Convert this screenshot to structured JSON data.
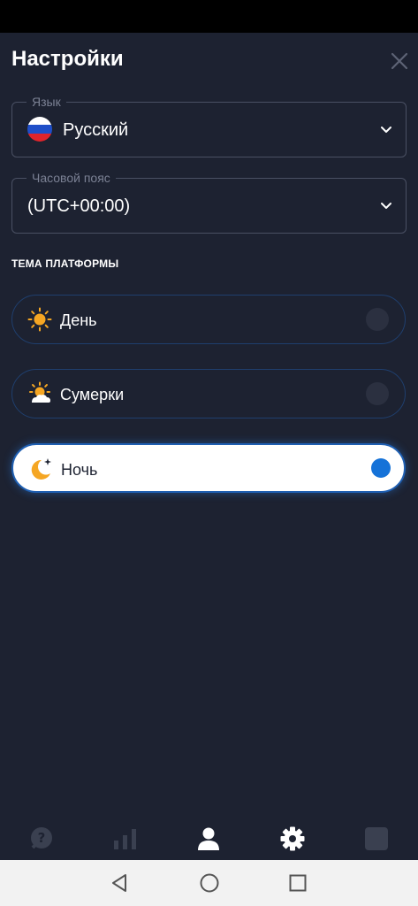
{
  "header": {
    "title": "Настройки"
  },
  "language": {
    "legend": "Язык",
    "value": "Русский",
    "flag": "russia-flag"
  },
  "timezone": {
    "legend": "Часовой пояс",
    "value": "(UTC+00:00)"
  },
  "theme": {
    "section_title": "ТЕМА ПЛАТФОРМЫ",
    "options": [
      {
        "label": "День",
        "icon": "sun-icon",
        "selected": false
      },
      {
        "label": "Сумерки",
        "icon": "sun-cloud-icon",
        "selected": false
      },
      {
        "label": "Ночь",
        "icon": "moon-icon",
        "selected": true
      }
    ]
  },
  "bottom_nav": {
    "items": [
      "help-icon",
      "chart-icon",
      "profile-icon",
      "settings-icon",
      "square-icon"
    ],
    "active": "profile-icon"
  },
  "system_nav": {
    "items": [
      "back-icon",
      "home-icon",
      "recents-icon"
    ]
  },
  "colors": {
    "background": "#1d2231",
    "accent": "#1572d8",
    "icon_orange": "#f5a623"
  }
}
